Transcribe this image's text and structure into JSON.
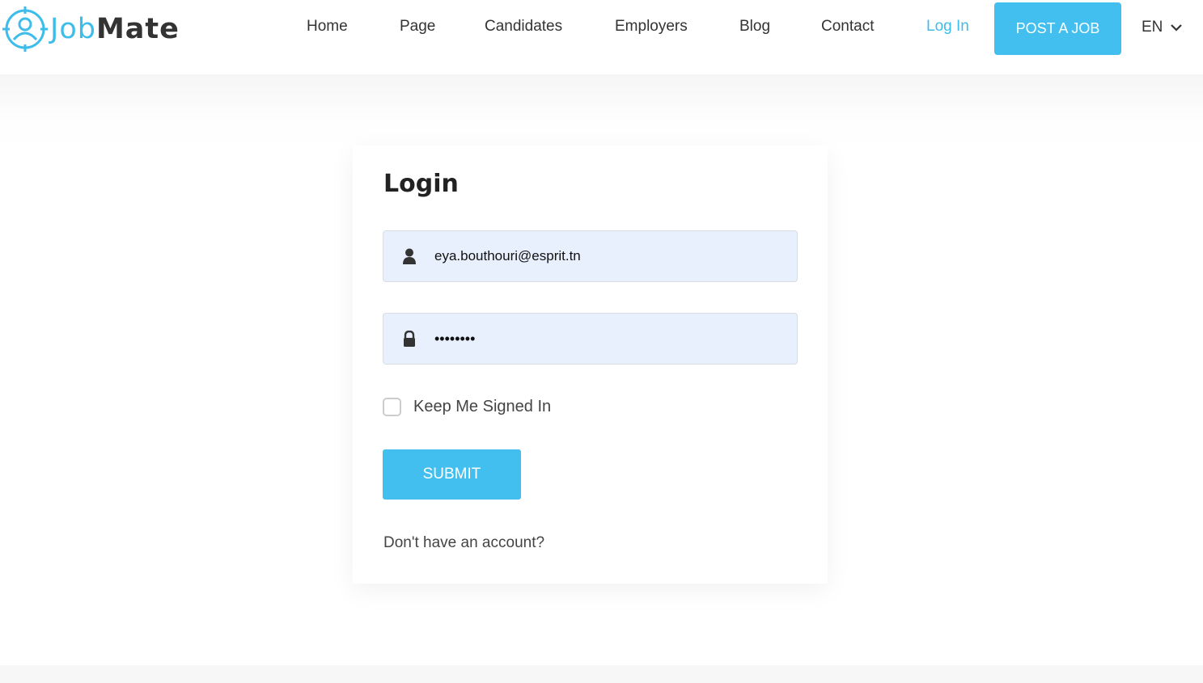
{
  "header": {
    "logo": {
      "part1": "Job",
      "part2": "Mate"
    },
    "nav": [
      {
        "label": "Home"
      },
      {
        "label": "Page"
      },
      {
        "label": "Candidates"
      },
      {
        "label": "Employers"
      },
      {
        "label": "Blog"
      },
      {
        "label": "Contact"
      },
      {
        "label": "Log In"
      }
    ],
    "post_job_label": "POST A JOB",
    "language": "EN"
  },
  "login": {
    "title": "Login",
    "email_value": "eya.bouthouri@esprit.tn",
    "password_value": "••••••••",
    "keep_signed_in_label": "Keep Me Signed In",
    "keep_signed_in_checked": false,
    "submit_label": "SUBMIT",
    "signup_prompt": "Don't have an account?"
  },
  "colors": {
    "accent": "#42bfee",
    "logo_blue": "#3ebdeb",
    "text_dark": "#333333",
    "field_bg": "#e8f0fe"
  },
  "icons": {
    "logo": "target-person-icon",
    "email_field": "user-icon",
    "password_field": "lock-icon",
    "language": "chevron-down-icon"
  }
}
